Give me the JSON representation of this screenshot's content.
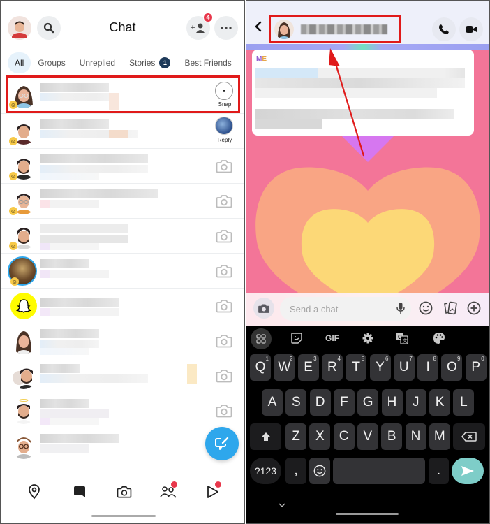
{
  "left_screen": {
    "header": {
      "title": "Chat",
      "add_friend_badge": "4"
    },
    "tabs": [
      {
        "label": "All",
        "active": true
      },
      {
        "label": "Groups"
      },
      {
        "label": "Unreplied"
      },
      {
        "label": "Stories",
        "count": "1"
      },
      {
        "label": "Best Friends"
      }
    ],
    "chats": [
      {
        "avatar": "bitmoji-woman-glasses",
        "status": "Snap",
        "action": "snap-icon",
        "highlighted": true
      },
      {
        "avatar": "bitmoji-man-dark-hair",
        "status": "Reply",
        "action": "reply-thumbnail"
      },
      {
        "avatar": "bitmoji-man-beard",
        "action": "camera-icon"
      },
      {
        "avatar": "bitmoji-man-glasses",
        "action": "camera-icon"
      },
      {
        "avatar": "bitmoji-man-beard-2",
        "action": "camera-icon"
      },
      {
        "avatar": "photo-story",
        "action": "camera-icon"
      },
      {
        "avatar": "snapchat-team",
        "action": "camera-icon"
      },
      {
        "avatar": "bitmoji-woman-long-hair",
        "action": "camera-icon"
      },
      {
        "avatar": "bitmoji-group",
        "action": "camera-icon"
      },
      {
        "avatar": "bitmoji-man-halo",
        "action": "camera-icon"
      },
      {
        "avatar": "bitmoji-man-hat-glasses",
        "action": "none"
      }
    ],
    "bottom_nav": [
      {
        "icon": "map-pin-icon"
      },
      {
        "icon": "chat-icon",
        "active": true
      },
      {
        "icon": "camera-icon"
      },
      {
        "icon": "friends-icon",
        "dot": true
      },
      {
        "icon": "play-icon",
        "dot": true
      }
    ]
  },
  "right_screen": {
    "header": {
      "contact_name": "[blurred name]"
    },
    "message": {
      "sender_first": "M",
      "sender_rest": "E"
    },
    "composer": {
      "placeholder": "Send a chat"
    },
    "keyboard": {
      "toolbar": [
        "apps-icon",
        "sticker-icon",
        "GIF",
        "settings-icon",
        "translate-icon",
        "palette-icon"
      ],
      "gif_label": "GIF",
      "row1": [
        "Q",
        "W",
        "E",
        "R",
        "T",
        "Y",
        "U",
        "I",
        "O",
        "P"
      ],
      "row1_hints": [
        "1",
        "2",
        "3",
        "4",
        "5",
        "6",
        "7",
        "8",
        "9",
        "0"
      ],
      "row2": [
        "A",
        "S",
        "D",
        "F",
        "G",
        "H",
        "J",
        "K",
        "L"
      ],
      "row3": [
        "Z",
        "X",
        "C",
        "V",
        "B",
        "N",
        "M"
      ],
      "symbols_label": "?123",
      "comma": ",",
      "period": "."
    }
  },
  "colors": {
    "highlight": "#e01a1a",
    "snap_blue": "#2ea7ec",
    "notification_red": "#e8374b",
    "send_teal": "#7ecdc8",
    "chat_bg_pink": "#f37598",
    "heart_outer": "#f9a584",
    "heart_inner": "#fcd877"
  }
}
